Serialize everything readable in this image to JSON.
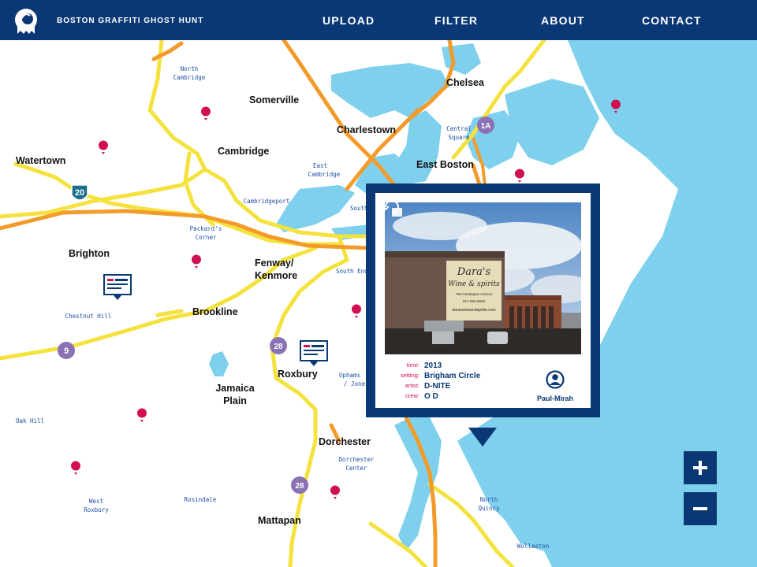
{
  "header": {
    "site_title": "BOSTON GRAFFITI GHOST HUNT",
    "nav": [
      "UPLOAD",
      "FILTER",
      "ABOUT",
      "CONTACT"
    ]
  },
  "map": {
    "neighborhoods": [
      "Chelsea",
      "Somerville",
      "Charlestown",
      "Watertown",
      "Cambridge",
      "East Boston",
      "Brighton",
      "Fenway/",
      "Kenmore",
      "Brookline",
      "Roxbury",
      "Jamaica",
      "Plain",
      "Dorchester",
      "Mattapan"
    ],
    "small_places": [
      "North",
      "Cambridge",
      "Central",
      "Square",
      "East",
      "Cambridge",
      "Cambridgeport",
      "Packard's",
      "Corner",
      "South",
      "South End",
      "Chestnut Hill",
      "Uphams",
      "/ Jones",
      "Oak Hill",
      "Dorchester",
      "Center",
      "West",
      "Roxbury",
      "Rosindale",
      "North",
      "Quincy",
      "Wollaston"
    ],
    "route_shields": [
      "20",
      "1A",
      "9",
      "28",
      "28"
    ],
    "icons": {
      "pin": "map-pin-icon",
      "card_marker": "graffiti-card-marker-icon"
    }
  },
  "popup": {
    "photo_sign_line1": "Dara's",
    "photo_sign_line2": "Wine & spirits",
    "photo_sign_line3": "756 Huntington Avenue",
    "photo_sign_line4": "617-566-6500",
    "photo_sign_line5": "daraswineandspirits.com",
    "details": [
      {
        "key": "time:",
        "value": "2013"
      },
      {
        "key": "setting:",
        "value": "Brigham Circle"
      },
      {
        "key": "artist:",
        "value": "D-NITE"
      },
      {
        "key": "crew:",
        "value": "O D"
      }
    ],
    "user": "Paul-Mirah"
  },
  "colors": {
    "navy": "#0a3875",
    "water": "#7fd0ec",
    "highway_yellow": "#f4e23e",
    "highway_orange": "#f39b2a",
    "pin": "#d0104f",
    "shield_purple": "#8b72b5"
  }
}
